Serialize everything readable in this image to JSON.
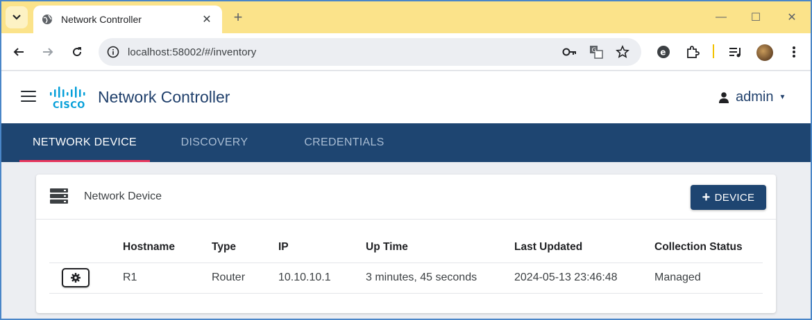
{
  "browser": {
    "tab_title": "Network Controller",
    "tab_close": "✕",
    "new_tab": "+",
    "url": "localhost:58002/#/inventory",
    "window_controls": {
      "minimize": "—",
      "maximize": "☐",
      "close": "✕"
    }
  },
  "icons": {
    "tab_search": "chevron-down-icon",
    "favicon": "globe-icon",
    "back": "back-arrow-icon",
    "forward": "forward-arrow-icon",
    "reload": "reload-icon",
    "site_info": "info-icon",
    "password": "key-icon",
    "translate": "translate-icon",
    "bookmark": "star-icon",
    "extension": "puzzle-icon",
    "media": "media-control-icon",
    "menu": "kebab-menu-icon"
  },
  "app": {
    "title": "Network Controller",
    "logo_text": "CISCO",
    "user": "admin"
  },
  "nav": {
    "tabs": [
      {
        "label": "NETWORK DEVICE",
        "active": true
      },
      {
        "label": "DISCOVERY",
        "active": false
      },
      {
        "label": "CREDENTIALS",
        "active": false
      }
    ]
  },
  "card": {
    "title": "Network Device",
    "add_button": "DEVICE",
    "add_button_prefix": "+"
  },
  "table": {
    "columns": [
      "",
      "Hostname",
      "Type",
      "IP",
      "Up Time",
      "Last Updated",
      "Collection Status"
    ],
    "rows": [
      {
        "hostname": "R1",
        "type": "Router",
        "ip": "10.10.10.1",
        "uptime": "3 minutes, 45 seconds",
        "last_updated": "2024-05-13 23:46:48",
        "status": "Managed"
      }
    ]
  },
  "colors": {
    "tab_strip": "#fbe38a",
    "brand_navy": "#1e4571",
    "active_underline": "#e8365d",
    "title_blue": "#1f3f6b",
    "cisco_blue": "#049fd9"
  }
}
